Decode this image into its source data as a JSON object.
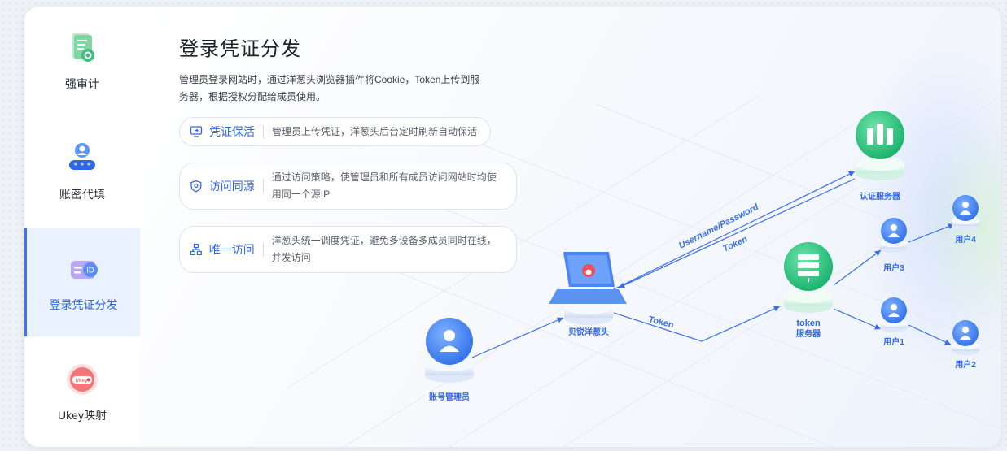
{
  "sidebar": {
    "items": [
      {
        "label": "强审计",
        "icon": "audit-icon"
      },
      {
        "label": "账密代填",
        "icon": "password-fill-icon"
      },
      {
        "label": "登录凭证分发",
        "icon": "credential-id-icon",
        "active": true
      },
      {
        "label": "Ukey映射",
        "icon": "ukey-icon"
      }
    ]
  },
  "main": {
    "title": "登录凭证分发",
    "description": "管理员登录网站时，通过洋葱头浏览器插件将Cookie，Token上传到服务器，根据授权分配给成员使用。",
    "features": [
      {
        "name": "凭证保活",
        "icon": "monitor-refresh-icon",
        "desc": "管理员上传凭证，洋葱头后台定时刷新自动保活"
      },
      {
        "name": "访问同源",
        "icon": "shield-location-icon",
        "desc": "通过访问策略，使管理员和所有成员访问网站时均使用同一个源IP"
      },
      {
        "name": "唯一访问",
        "icon": "network-tree-icon",
        "desc": "洋葱头统一调度凭证，避免多设备多成员同时在线，并发访问"
      }
    ]
  },
  "diagram": {
    "nodes": {
      "admin": "账号管理员",
      "onion": "贝锐洋葱头",
      "auth_server": "认证服务器",
      "token_server_line1": "token",
      "token_server_line2": "服务器",
      "user1": "用户1",
      "user2": "用户2",
      "user3": "用户3",
      "user4": "用户4"
    },
    "edges": {
      "up_label": "Username/Password",
      "down_label": "Token",
      "token_label": "Token"
    }
  },
  "colors": {
    "accent": "#2f66e8",
    "active_bg": "#eaf1ff",
    "server_green": "#22c07a",
    "user_blue": "#3a7ff0"
  }
}
